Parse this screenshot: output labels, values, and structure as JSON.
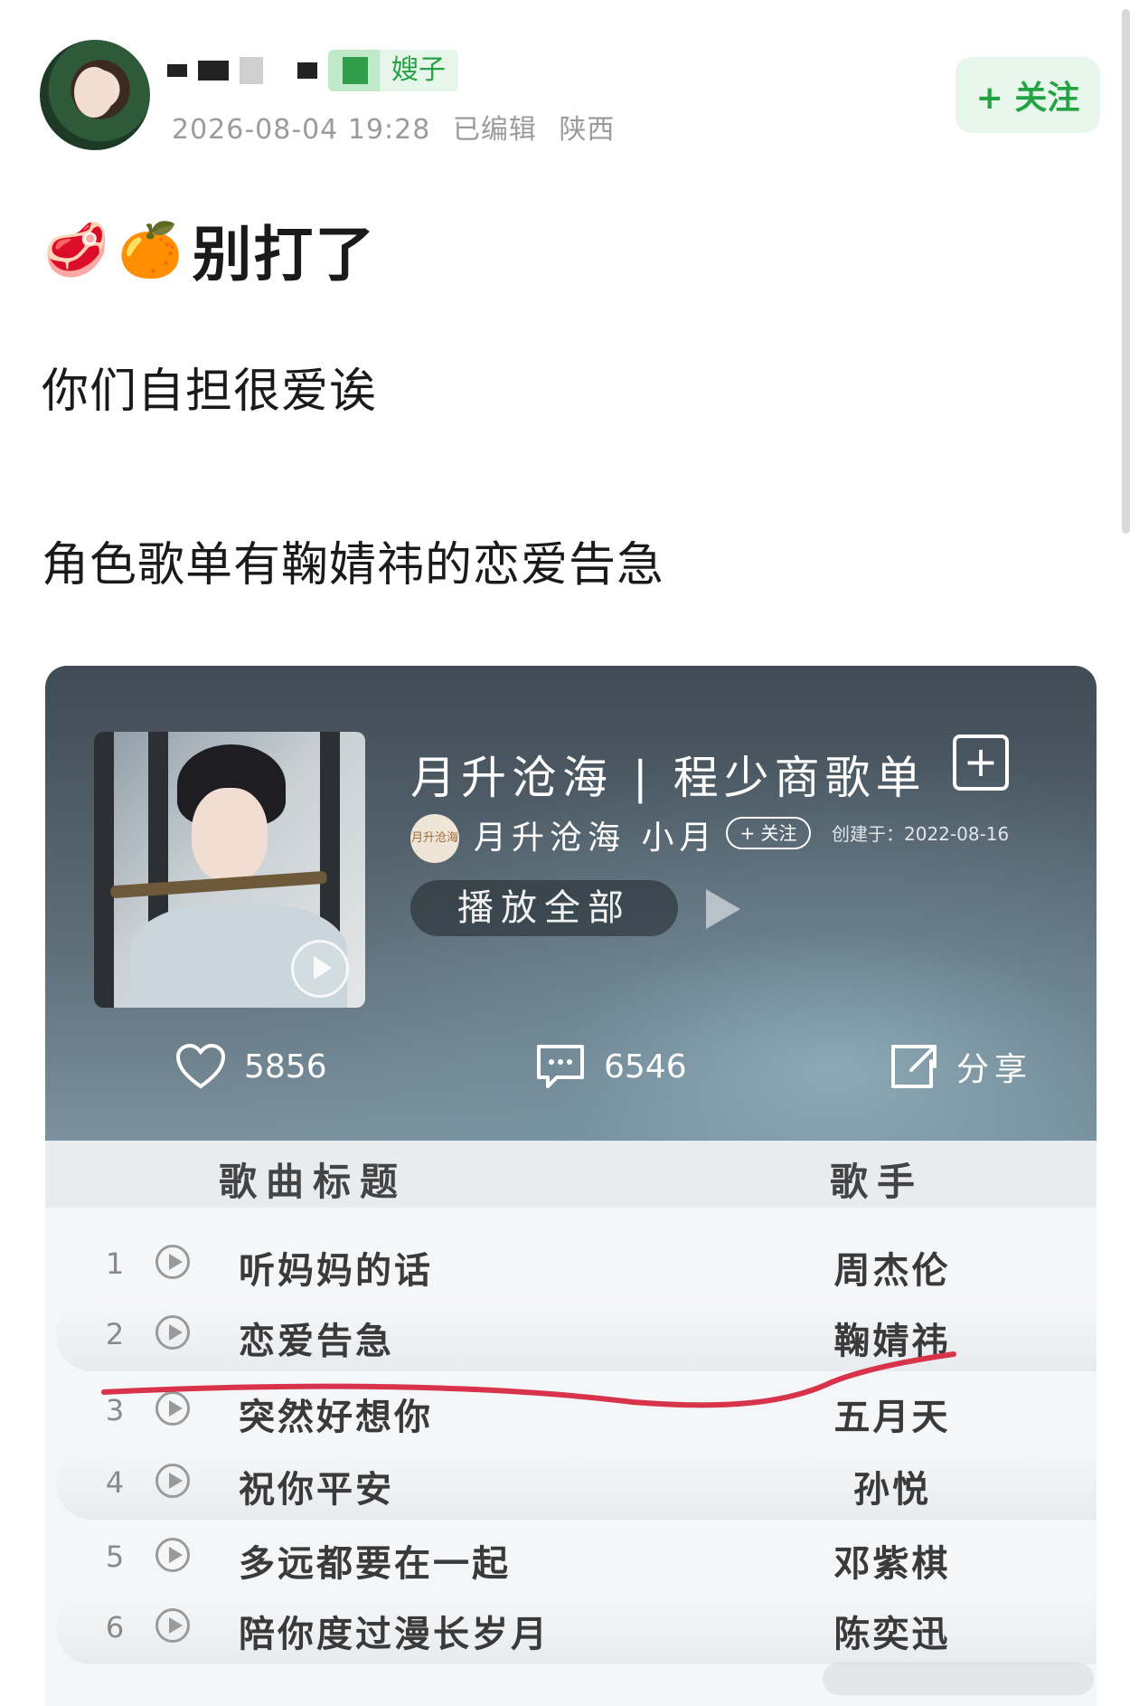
{
  "post": {
    "author_name_suffix": "嫂子",
    "timestamp": "2026-08-04 19:28",
    "edited": "已编辑",
    "location": "陕西",
    "follow_label": "+ 关注",
    "title_emojis": [
      "🥩",
      "🍊"
    ],
    "title": "别打了",
    "lines": [
      "你们自担很爱诶",
      "角色歌单有鞠婧祎的恋爱告急"
    ]
  },
  "playlist": {
    "title": "月升沧海 | 程少商歌单",
    "creator_logo_text": "月升沧海",
    "creator": "月升沧海 小月",
    "follow_label": "+ 关注",
    "created": "创建于：2022-08-16",
    "play_all": "播放全部",
    "likes": "5856",
    "comments": "6546",
    "share": "分享",
    "col_title": "歌曲标题",
    "col_artist": "歌手",
    "songs": [
      {
        "num": "1",
        "title": "听妈妈的话",
        "artist": "周杰伦"
      },
      {
        "num": "2",
        "title": "恋爱告急",
        "artist": "鞠婧祎"
      },
      {
        "num": "3",
        "title": "突然好想你",
        "artist": "五月天"
      },
      {
        "num": "4",
        "title": "祝你平安",
        "artist": "孙悦"
      },
      {
        "num": "5",
        "title": "多远都要在一起",
        "artist": "邓紫棋"
      },
      {
        "num": "6",
        "title": "陪你度过漫长岁月",
        "artist": "陈奕迅"
      }
    ]
  },
  "colors": {
    "accent_green": "#23a344",
    "annotation_red": "#d8334a"
  },
  "icons": [
    "heart-icon",
    "comment-icon",
    "share-icon",
    "play-icon",
    "plus-square-icon"
  ]
}
